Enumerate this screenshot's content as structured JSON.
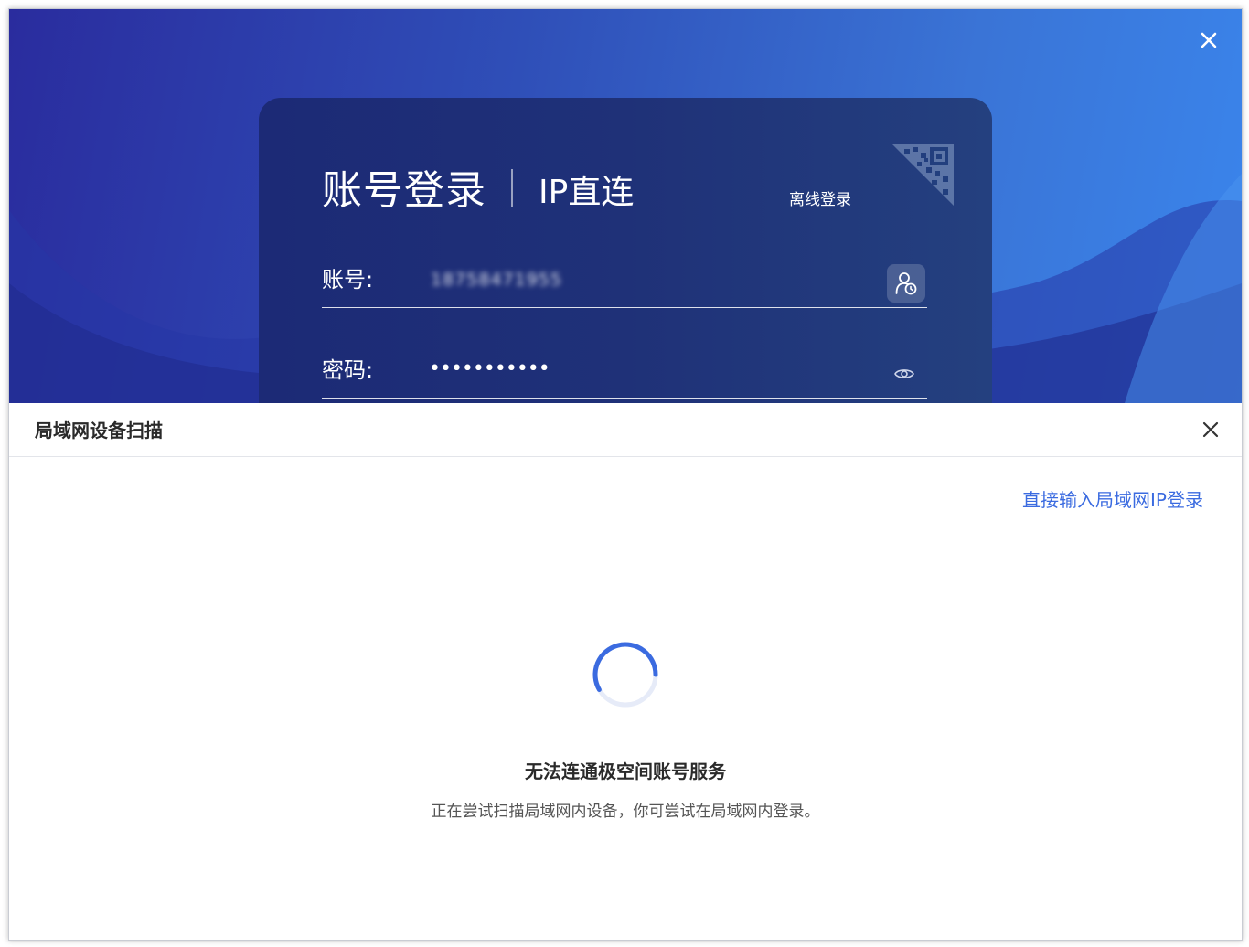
{
  "login": {
    "tab_account": "账号登录",
    "tab_ip": "IP直连",
    "offline_login": "离线登录",
    "account_label": "账号:",
    "account_value": "18758471955",
    "password_label": "密码:",
    "password_value": "•••••••••••"
  },
  "dialog": {
    "title": "局域网设备扫描",
    "direct_ip_link": "直接输入局域网IP登录",
    "status_title": "无法连通极空间账号服务",
    "status_desc": "正在尝试扫描局域网内设备，你可尝试在局域网内登录。"
  },
  "icons": {
    "window_close": "close-icon",
    "qr": "qr-code-icon",
    "account_history": "user-history-icon",
    "password_visibility": "eye-icon",
    "dialog_close": "close-icon",
    "loading": "spinner-icon"
  },
  "colors": {
    "hero_start": "#2a2c9e",
    "hero_end": "#3a85ec",
    "card": "#1f3178",
    "link": "#3b6be0",
    "spinner": "#3b6be0"
  }
}
